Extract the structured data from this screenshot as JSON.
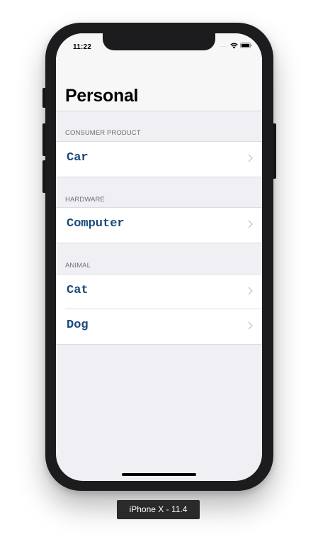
{
  "status_bar": {
    "time": "11:22",
    "signal": "....",
    "icons": [
      "wifi-icon",
      "battery-icon"
    ]
  },
  "nav": {
    "title": "Personal"
  },
  "sections": [
    {
      "header": "CONSUMER PRODUCT",
      "items": [
        {
          "label": "Car",
          "accessory": "chevron-right-icon"
        }
      ]
    },
    {
      "header": "HARDWARE",
      "items": [
        {
          "label": "Computer",
          "accessory": "chevron-right-icon"
        }
      ]
    },
    {
      "header": "ANIMAL",
      "items": [
        {
          "label": "Cat",
          "accessory": "chevron-right-icon"
        },
        {
          "label": "Dog",
          "accessory": "chevron-right-icon"
        }
      ]
    }
  ],
  "simulator": {
    "device_label": "iPhone X - 11.4"
  },
  "colors": {
    "cell_label": "#1a4a7a",
    "grouped_background": "#efeff4",
    "section_header": "#6d6d72",
    "chevron": "#c7c7cc"
  }
}
